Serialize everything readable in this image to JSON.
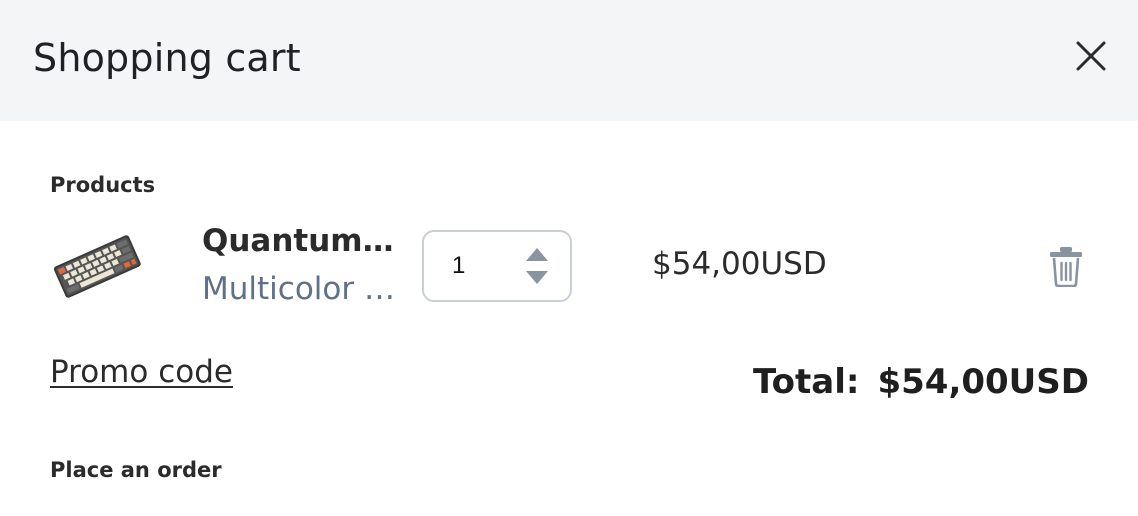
{
  "header": {
    "title": "Shopping cart",
    "close_icon": "close-icon"
  },
  "products_section": {
    "label": "Products",
    "items": [
      {
        "image_icon": "keyboard-image",
        "name": "QuantumB...",
        "variant": "Multicolor /...",
        "quantity": "1",
        "price": "$54,00USD",
        "remove_icon": "trash-icon"
      }
    ]
  },
  "promo": {
    "label": "Promo code"
  },
  "total": {
    "label": "Total:",
    "value": "$54,00USD"
  },
  "order_section": {
    "label": "Place an order"
  },
  "colors": {
    "header_bg": "#f4f5f7",
    "variant_text": "#5f7089",
    "stepper_border": "#c9ced8",
    "icon_gray": "#8a93a0"
  }
}
